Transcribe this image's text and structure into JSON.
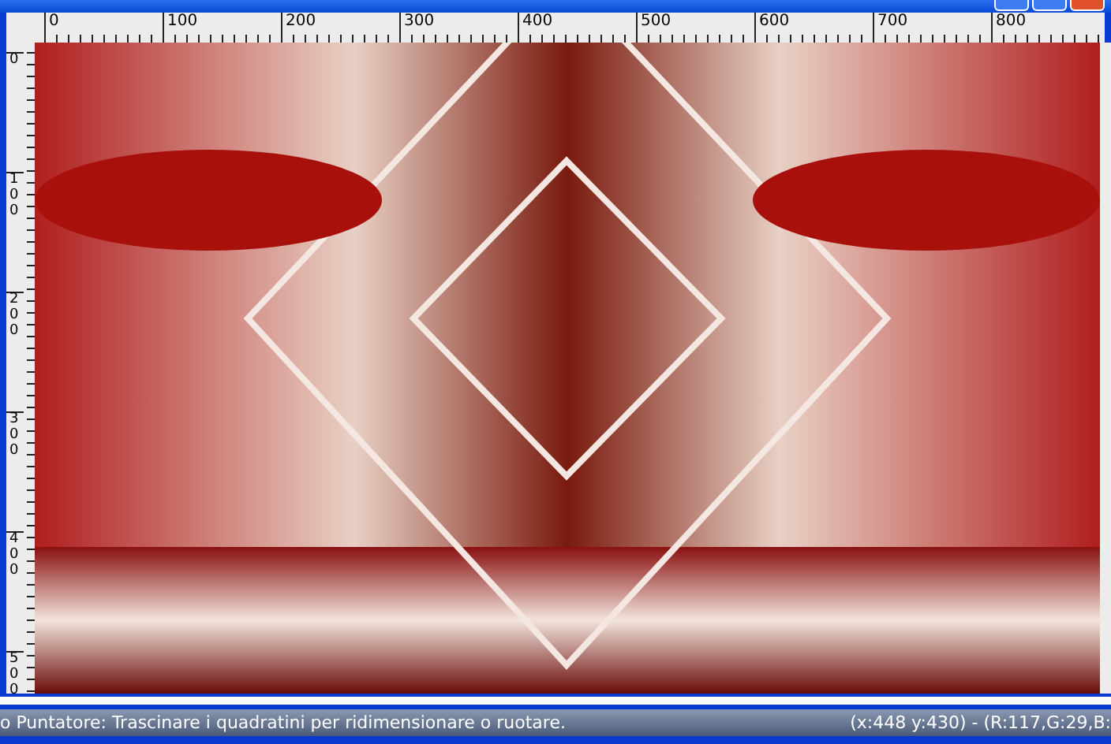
{
  "ruler_horizontal": {
    "labels": [
      "0",
      "100",
      "200",
      "300",
      "400",
      "500",
      "600",
      "700",
      "800"
    ]
  },
  "ruler_vertical": {
    "labels": [
      "0",
      "100",
      "200",
      "300",
      "400",
      "500"
    ]
  },
  "status_bar": {
    "hint": "o Puntatore: Trascinare i quadratini per ridimensionare o ruotare.",
    "info": "(x:448 y:430) - (R:117,G:29,B:"
  }
}
